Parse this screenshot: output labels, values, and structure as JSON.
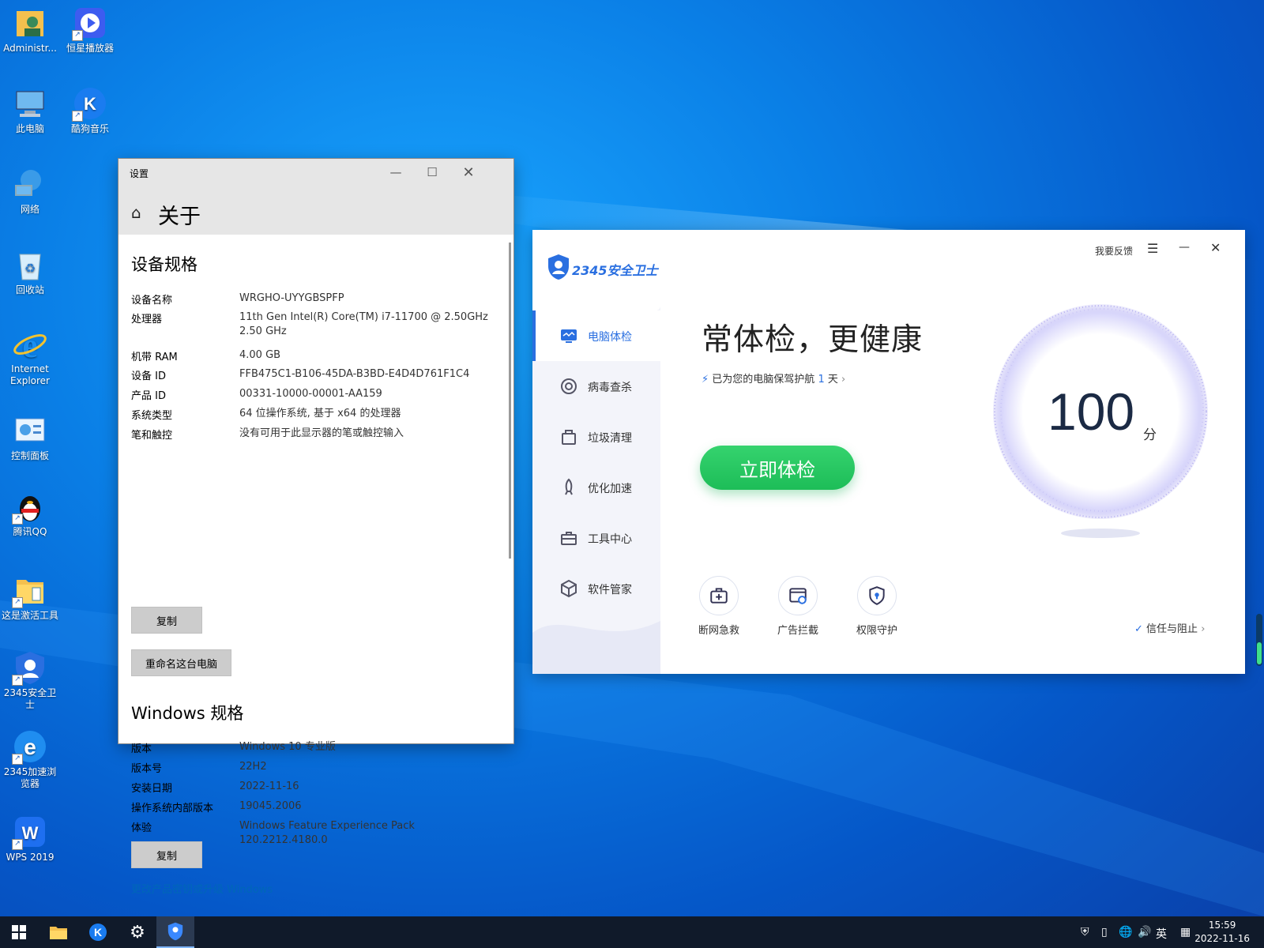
{
  "desktop": {
    "icons": [
      {
        "label": "Administr...",
        "icon": "user-folder-icon"
      },
      {
        "label": "恒星播放器",
        "icon": "media-player-icon"
      },
      {
        "label": "此电脑",
        "icon": "computer-icon"
      },
      {
        "label": "酷狗音乐",
        "icon": "kugou-music-icon"
      },
      {
        "label": "网络",
        "icon": "network-icon"
      },
      {
        "label": "回收站",
        "icon": "recycle-bin-icon"
      },
      {
        "label": "Internet\nExplorer",
        "icon": "ie-icon"
      },
      {
        "label": "控制面板",
        "icon": "control-panel-icon"
      },
      {
        "label": "腾讯QQ",
        "icon": "qq-icon"
      },
      {
        "label": "这是激活工具",
        "icon": "folder-icon"
      },
      {
        "label": "2345安全卫士",
        "icon": "shield-icon"
      },
      {
        "label": "2345加速浏览器",
        "icon": "browser-icon"
      },
      {
        "label": "WPS 2019",
        "icon": "wps-icon"
      }
    ]
  },
  "settings": {
    "window_title": "设置",
    "page_title": "关于",
    "device_section_title": "设备规格",
    "device_specs": [
      {
        "key": "设备名称",
        "value": "WRGHO-UYYGBSPFP"
      },
      {
        "key": "处理器",
        "value": "11th Gen Intel(R) Core(TM) i7-11700 @ 2.50GHz   2.50 GHz"
      },
      {
        "key": "机带 RAM",
        "value": "4.00 GB"
      },
      {
        "key": "设备 ID",
        "value": "FFB475C1-B106-45DA-B3BD-E4D4D761F1C4"
      },
      {
        "key": "产品 ID",
        "value": "00331-10000-00001-AA159"
      },
      {
        "key": "系统类型",
        "value": "64 位操作系统, 基于 x64 的处理器"
      },
      {
        "key": "笔和触控",
        "value": "没有可用于此显示器的笔或触控输入"
      }
    ],
    "copy_label": "复制",
    "rename_label": "重命名这台电脑",
    "windows_section_title": "Windows 规格",
    "windows_specs": [
      {
        "key": "版本",
        "value": "Windows 10 专业版"
      },
      {
        "key": "版本号",
        "value": "22H2"
      },
      {
        "key": "安装日期",
        "value": "2022-11-16"
      },
      {
        "key": "操作系统内部版本",
        "value": "19045.2006"
      },
      {
        "key": "体验",
        "value": "Windows Feature Experience Pack 120.2212.4180.0"
      }
    ],
    "copy2_label": "复制",
    "product_key_link": "更改产品密钥或升级 Windows"
  },
  "guard": {
    "logo_text": "2345安全卫士",
    "feedback": "我要反馈",
    "nav": [
      {
        "label": "电脑体检",
        "icon": "monitor-icon",
        "active": true
      },
      {
        "label": "病毒查杀",
        "icon": "target-icon",
        "active": false
      },
      {
        "label": "垃圾清理",
        "icon": "trash-icon",
        "active": false
      },
      {
        "label": "优化加速",
        "icon": "rocket-icon",
        "active": false
      },
      {
        "label": "工具中心",
        "icon": "toolbox-icon",
        "active": false
      },
      {
        "label": "软件管家",
        "icon": "box-icon",
        "active": false
      }
    ],
    "headline": "常体检，更健康",
    "protect_prefix": "已为您的电脑保驾护航",
    "protect_days": "1",
    "protect_suffix": "天",
    "check_button": "立即体检",
    "score": "100",
    "score_unit": "分",
    "tools": [
      {
        "label": "断网急救",
        "icon": "first-aid-icon"
      },
      {
        "label": "广告拦截",
        "icon": "ad-block-icon"
      },
      {
        "label": "权限守护",
        "icon": "lock-shield-icon"
      }
    ],
    "trust": "信任与阻止",
    "accent": "#2a6fe0",
    "button_color": "#22c45e"
  },
  "taskbar": {
    "ime": "英",
    "time": "15:59",
    "date": "2022-11-16"
  }
}
